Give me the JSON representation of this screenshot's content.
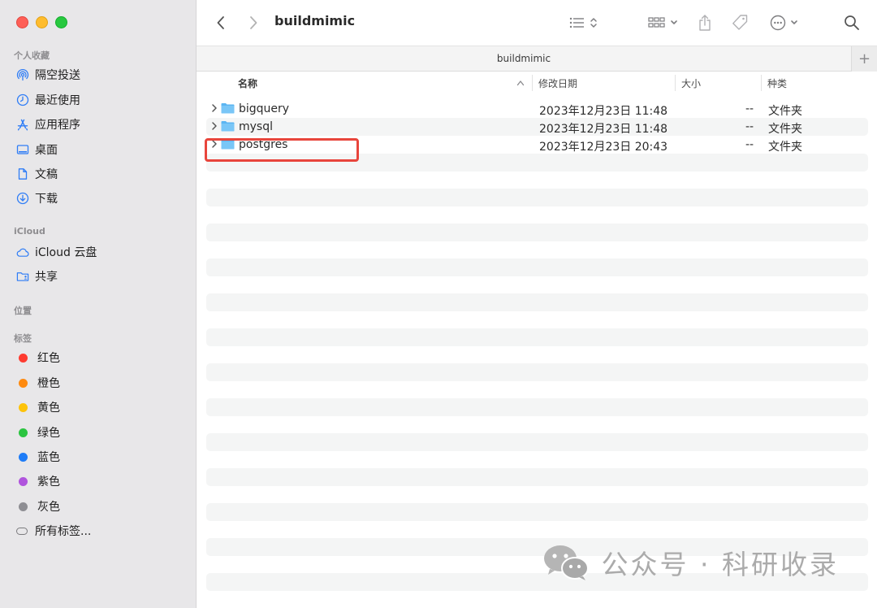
{
  "window": {
    "title": "buildmimic",
    "tab_title": "buildmimic"
  },
  "sidebar": {
    "sections": {
      "favorites": "个人收藏",
      "icloud": "iCloud",
      "locations": "位置",
      "tags": "标签"
    },
    "favorites": [
      {
        "label": "隔空投送",
        "icon": "airdrop-icon"
      },
      {
        "label": "最近使用",
        "icon": "clock-icon"
      },
      {
        "label": "应用程序",
        "icon": "applications-icon"
      },
      {
        "label": "桌面",
        "icon": "desktop-icon"
      },
      {
        "label": "文稿",
        "icon": "document-icon"
      },
      {
        "label": "下载",
        "icon": "download-icon"
      }
    ],
    "icloud": [
      {
        "label": "iCloud 云盘",
        "icon": "cloud-icon"
      },
      {
        "label": "共享",
        "icon": "shared-folder-icon"
      }
    ],
    "tags": [
      {
        "label": "红色",
        "color": "#fe3b30"
      },
      {
        "label": "橙色",
        "color": "#fe8a10"
      },
      {
        "label": "黄色",
        "color": "#fdc30a"
      },
      {
        "label": "绿色",
        "color": "#2bc440"
      },
      {
        "label": "蓝色",
        "color": "#1e7cf7"
      },
      {
        "label": "紫色",
        "color": "#b054dd"
      },
      {
        "label": "灰色",
        "color": "#8e8e93"
      },
      {
        "label": "所有标签...",
        "color": ""
      }
    ]
  },
  "columns": {
    "name": "名称",
    "modified": "修改日期",
    "size": "大小",
    "kind": "种类"
  },
  "files": [
    {
      "name": "bigquery",
      "modified": "2023年12月23日 11:48",
      "size": "--",
      "kind": "文件夹"
    },
    {
      "name": "mysql",
      "modified": "2023年12月23日 11:48",
      "size": "--",
      "kind": "文件夹"
    },
    {
      "name": "postgres",
      "modified": "2023年12月23日 20:43",
      "size": "--",
      "kind": "文件夹"
    }
  ],
  "watermark": "公众号 · 科研收录",
  "colors": {
    "accent": "#2f7df6",
    "folder": "#5bb5f2",
    "highlight": "#e8453c"
  }
}
